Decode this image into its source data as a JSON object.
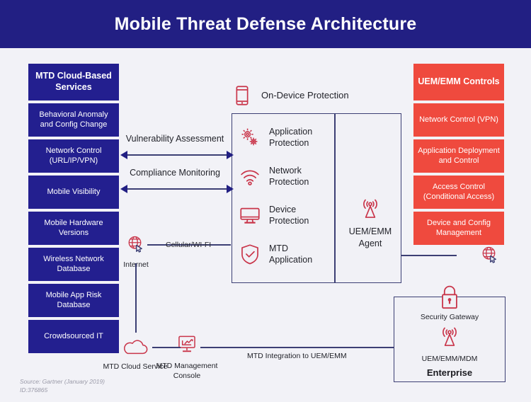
{
  "header": {
    "title": "Mobile Threat Defense Architecture"
  },
  "colors": {
    "brand_blue": "#221f83",
    "brand_red": "#ef4a3e",
    "background": "#f2f2f7",
    "line": "#3c3f74",
    "text": "#23242b"
  },
  "mtd_stack": {
    "title": "MTD Cloud-Based Services",
    "items": [
      "Behavioral Anomaly and Config Change",
      "Network Control (URL/IP/VPN)",
      "Mobile Visibility",
      "Mobile Hardware Versions",
      "Wireless Network Database",
      "Mobile App Risk Database",
      "Crowdsourced IT"
    ]
  },
  "uem_stack": {
    "title": "UEM/EMM Controls",
    "items": [
      "Network Control (VPN)",
      "Application Deployment and Control",
      "Access Control (Conditional Access)",
      "Device and Config Management"
    ]
  },
  "on_device": {
    "label": "On-Device Protection",
    "icon": "smartphone-icon"
  },
  "center": {
    "features": [
      {
        "label": "Application Protection",
        "icon": "gears-icon"
      },
      {
        "label": "Network Protection",
        "icon": "wifi-icon"
      },
      {
        "label": "Device Protection",
        "icon": "monitor-icon"
      },
      {
        "label": "MTD Application",
        "icon": "shield-check-icon"
      }
    ],
    "agent": {
      "label": "UEM/EMM Agent",
      "icon": "antenna-icon"
    }
  },
  "arrows": [
    {
      "label": "Vulnerability Assessment"
    },
    {
      "label": "Compliance Monitoring"
    }
  ],
  "nodes": {
    "internet_left": {
      "label": "Internet",
      "icon": "globe-cursor-icon"
    },
    "internet_right": {
      "label": "",
      "icon": "globe-cursor-icon"
    },
    "mtd_cloud_service": {
      "label": "MTD Cloud Service",
      "icon": "cloud-icon"
    },
    "mtd_management_console": {
      "label": "MTD Management Console",
      "icon": "monitor-chart-icon"
    }
  },
  "link_labels": {
    "cellular": "Cellular/WI-FI",
    "mtd_integration": "MTD Integration to UEM/EMM"
  },
  "enterprise": {
    "security_gateway": "Security Gateway",
    "security_gateway_icon": "lock-icon",
    "uem_emm_mdm": "UEM/EMM/MDM",
    "uem_emm_mdm_icon": "antenna-icon",
    "title": "Enterprise"
  },
  "source": {
    "line1": "Source: Gartner (January 2019)",
    "line2": "ID:376865"
  }
}
